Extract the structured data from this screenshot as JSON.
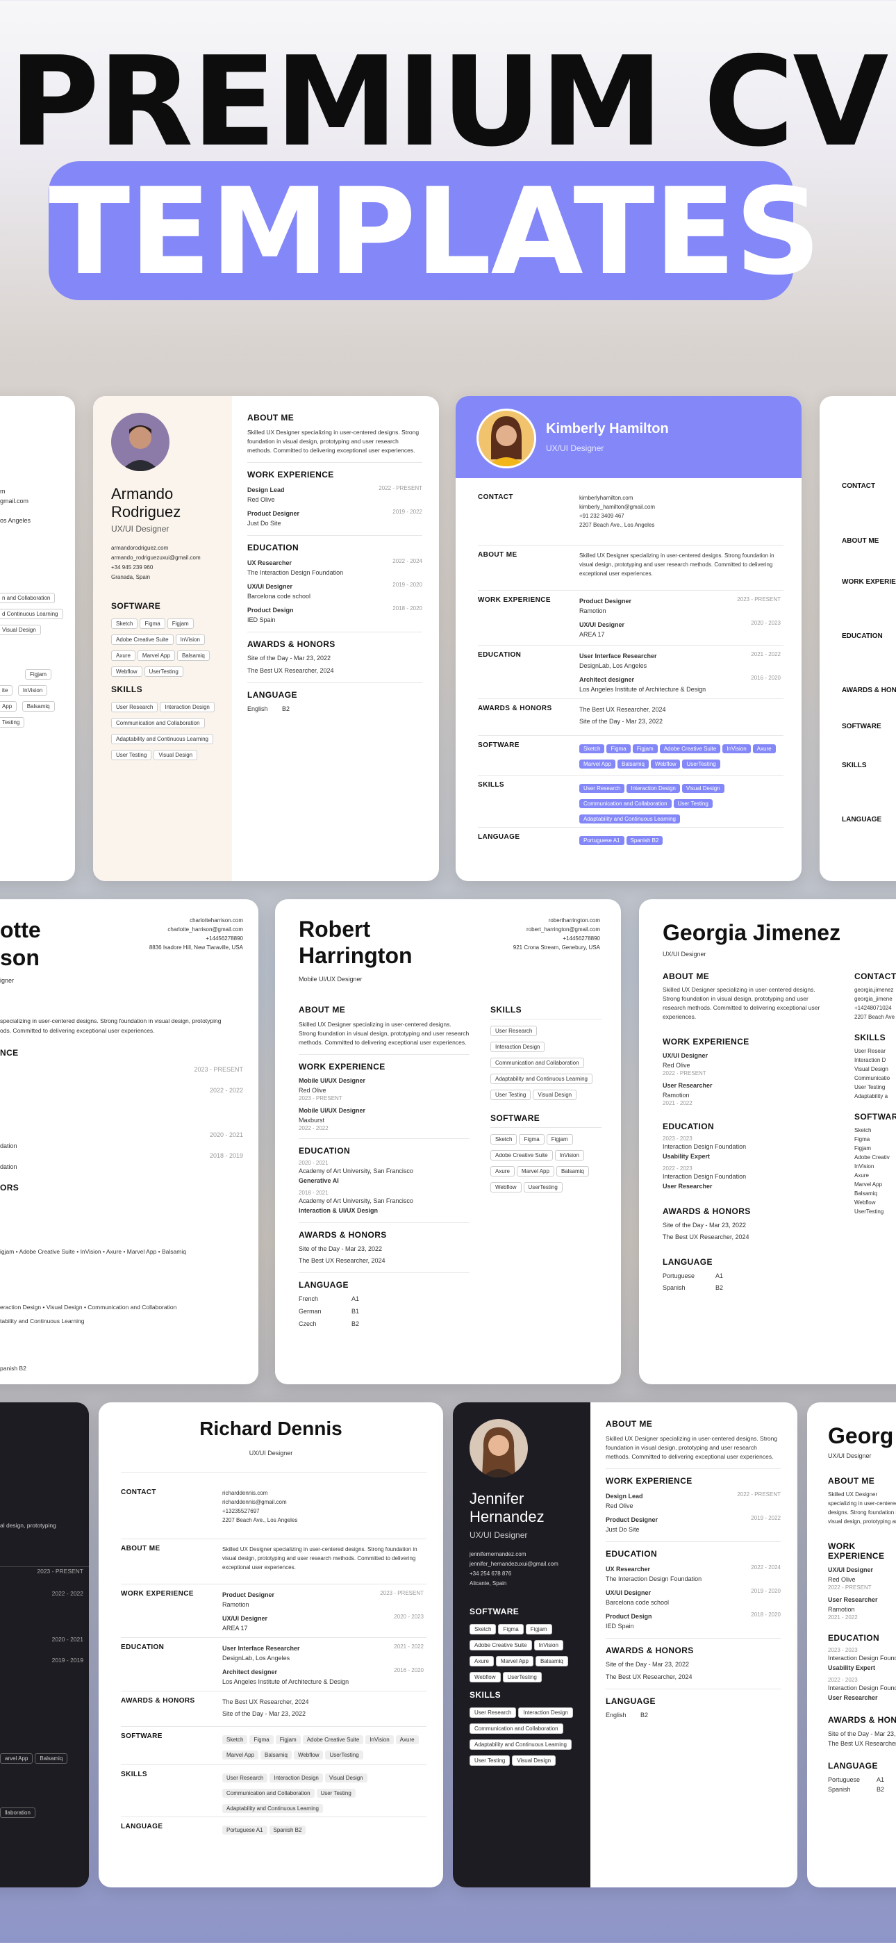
{
  "title_line1": "PREMIUM CV",
  "title_line2": "TEMPLATES",
  "about": "Skilled UX Designer specializing in user-centered designs. Strong foundation in visual design, prototyping and user research methods. Committed to delivering exceptional user experiences.",
  "armando": {
    "name": "Armando Rodriguez",
    "role": "UX/UI Designer",
    "contact": [
      "armandorodriguez.com",
      "armando_rodriguezuxui@gmail.com",
      "+34 945 239 960",
      "Granada, Spain"
    ],
    "software": [
      "Sketch",
      "Figma",
      "Figjam",
      "Adobe Creative Suite",
      "InVision",
      "Axure",
      "Marvel App",
      "Balsamiq",
      "Webflow",
      "UserTesting"
    ],
    "skills": [
      "User Research",
      "Interaction Design",
      "Communication and Collaboration",
      "Adaptability and Continuous Learning",
      "User Testing",
      "Visual Design"
    ],
    "jobs": [
      {
        "t": "Design Lead",
        "c": "Red Olive",
        "d": "2022 - PRESENT"
      },
      {
        "t": "Product Designer",
        "c": "Just Do Site",
        "d": "2019 - 2022"
      }
    ],
    "edu": [
      {
        "t": "UX Researcher",
        "c": "The Interaction Design Foundation",
        "d": "2022 - 2024"
      },
      {
        "t": "UX/UI Designer",
        "c": "Barcelona code school",
        "d": "2019 - 2020"
      },
      {
        "t": "Product Design",
        "c": "IED Spain",
        "d": "2018 - 2020"
      }
    ],
    "awards": [
      "Site of the Day - Mar 23, 2022",
      "The Best UX Researcher, 2024"
    ],
    "lang": "English",
    "lvl": "B2"
  },
  "kimberly": {
    "name": "Kimberly Hamilton",
    "role": "UX/UI Designer",
    "contact": [
      "kimberlyhamilton.com",
      "kimberly_hamilton@gmail.com",
      "+91 232 3409 467",
      "2207 Beach Ave., Los Angeles"
    ],
    "jobs": [
      {
        "t": "Product Designer",
        "c": "Ramotion",
        "d": "2023 - PRESENT"
      },
      {
        "t": "UX/UI Designer",
        "c": "AREA 17",
        "d": "2020 - 2023"
      }
    ],
    "edu": [
      {
        "t": "User Interface Researcher",
        "c": "DesignLab, Los Angeles",
        "d": "2021 - 2022"
      },
      {
        "t": "Architect designer",
        "c": "Los Angeles Institute of Architecture & Design",
        "d": "2016 - 2020"
      }
    ],
    "awards": [
      "The Best UX Researcher, 2024",
      "Site of the Day - Mar 23, 2022"
    ],
    "software": [
      "Sketch",
      "Figma",
      "Figjam",
      "Adobe Creative Suite",
      "InVision",
      "Axure",
      "Marvel App",
      "Balsamiq",
      "Webflow",
      "UserTesting"
    ],
    "skills": [
      "User Research",
      "Interaction Design",
      "Visual Design",
      "Communication and Collaboration",
      "User Testing",
      "Adaptability and Continuous Learning"
    ],
    "langs": [
      {
        "l": "Portuguese",
        "v": "A1"
      },
      {
        "l": "Spanish",
        "v": "B2"
      }
    ]
  },
  "labels": {
    "about": "ABOUT ME",
    "work": "WORK EXPERIENCE",
    "edu": "EDUCATION",
    "awards": "AWARDS & HONORS",
    "lang": "LANGUAGE",
    "software": "SOFTWARE",
    "skills": "SKILLS",
    "contact": "CONTACT"
  },
  "charlotte": {
    "name1": "otte",
    "name2": "son",
    "role": "igner",
    "contact": [
      "charlotteharrison.com",
      "charlotte_harrison@gmail.com",
      "+14456278890",
      "8836 Isadore Hill, New Tiaraville, USA"
    ],
    "about": "specializing in user-centered designs. Strong foundation in visual design, prototyping ods. Committed to delivering exceptional user experiences.",
    "d1": "2023 - PRESENT",
    "d2": "2022 - 2022",
    "d3": "2020 - 2021",
    "d4": "2018 - 2019",
    "sw": "igjam  •  Adobe Creative Suite  •  InVision  •  Axure  •  Marvel App  •  Balsamiq",
    "sk": "eraction Design  •  Visual Design  •  Communication and Collaboration",
    "sk2": "tability and Continuous Learning",
    "lang": "panish   B2",
    "w": "NCE",
    "o": "ORS",
    "n1": "dation",
    "n2": "dation"
  },
  "robert": {
    "name": "Robert Harrington",
    "role": "Mobile UI/UX Designer",
    "contact": [
      "robertharrington.com",
      "robert_harrington@gmail.com",
      "+14456278890",
      "921 Crona Stream, Genebury, USA"
    ],
    "jobs": [
      {
        "t": "Mobile UI/UX Designer",
        "c": "Red Olive",
        "d": "2023 - PRESENT"
      },
      {
        "t": "Mobile UI/UX Designer",
        "c": "Maxburst",
        "d": "2022 - 2022"
      }
    ],
    "edu": [
      {
        "d": "2020 - 2021",
        "c": "Academy of Art University, San Francisco",
        "t": "Generative AI"
      },
      {
        "d": "2018 - 2021",
        "c": "Academy of Art University, San Francisco",
        "t": "Interaction & UI/UX Design"
      }
    ],
    "langs": [
      {
        "l": "French",
        "v": "A1"
      },
      {
        "l": "German",
        "v": "B1"
      },
      {
        "l": "Czech",
        "v": "B2"
      }
    ],
    "skills": [
      "User Research",
      "Interaction Design",
      "Communication and Collaboration",
      "Adaptability and Continuous Learning",
      "User Testing",
      "Visual Design"
    ],
    "software": [
      "Sketch",
      "Figma",
      "Figjam",
      "Adobe Creative Suite",
      "InVision",
      "Axure",
      "Marvel App",
      "Balsamiq",
      "Webflow",
      "UserTesting"
    ]
  },
  "georgia": {
    "name": "Georgia Jimenez",
    "role": "UX/UI Designer",
    "jobs": [
      {
        "t": "UX/UI Designer",
        "c": "Red Olive",
        "d": "2022 - PRESENT"
      },
      {
        "t": "User Researcher",
        "c": "Ramotion",
        "d": "2021 - 2022"
      }
    ],
    "edu": [
      {
        "d": "2023 - 2023",
        "c": "Interaction Design Foundation",
        "t": "Usability Expert"
      },
      {
        "d": "2022 - 2023",
        "c": "Interaction Design Foundation",
        "t": "User Researcher"
      }
    ],
    "langs": [
      {
        "l": "Portuguese",
        "v": "A1"
      },
      {
        "l": "Spanish",
        "v": "B2"
      }
    ],
    "contact": [
      "georgia.jimenez",
      "georgia_jimene",
      "+14248071024",
      "2207 Beach Ave"
    ],
    "skills": [
      "User Resear",
      "Interaction D",
      "Visual Design",
      "Communicatio",
      "User Testing",
      "Adaptability a"
    ],
    "software": [
      "Sketch",
      "Figma",
      "Figjam",
      "Adobe Creativ",
      "InVision",
      "Axure",
      "Marvel App",
      "Balsamiq",
      "Webflow",
      "UserTesting"
    ],
    "name_cut": "Georg"
  },
  "richard": {
    "name": "Richard Dennis",
    "role": "UX/UI Designer",
    "contact": [
      "richarddennis.com",
      "richarddennis@gmail.com",
      "+13235527697",
      "2207 Beach Ave., Los Angeles"
    ],
    "jobs": [
      {
        "t": "Product Designer",
        "c": "Ramotion",
        "d": "2023 - PRESENT"
      },
      {
        "t": "UX/UI Designer",
        "c": "AREA 17",
        "d": "2020 - 2023"
      }
    ],
    "edu": [
      {
        "t": "User Interface Researcher",
        "c": "DesignLab, Los Angeles",
        "d": "2021 - 2022"
      },
      {
        "t": "Architect designer",
        "c": "Los Angeles Institute of Architecture & Design",
        "d": "2016 - 2020"
      }
    ],
    "awards": [
      "The Best UX Researcher, 2024",
      "Site of the Day - Mar 23, 2022"
    ],
    "software": [
      "Sketch",
      "Figma",
      "Figjam",
      "Adobe Creative Suite",
      "InVision",
      "Axure",
      "Marvel App",
      "Balsamiq",
      "Webflow",
      "UserTesting"
    ],
    "skills": [
      "User Research",
      "Interaction Design",
      "Visual Design",
      "Communication and Collaboration",
      "User Testing",
      "Adaptability and Continuous Learning"
    ],
    "langs": [
      {
        "l": "Portuguese",
        "v": "A1"
      },
      {
        "l": "Spanish",
        "v": "B2"
      }
    ]
  },
  "jennifer": {
    "name": "Jennifer Hernandez",
    "role": "UX/UI Designer",
    "contact": [
      "jennifernernandez.com",
      "jennifer_hernandezuxui@gmail.com",
      "+34 254 678 876",
      "Alicante, Spain"
    ],
    "software": [
      "Sketch",
      "Figma",
      "Figjam",
      "Adobe Creative Suite",
      "InVision",
      "Axure",
      "Marvel App",
      "Balsamiq",
      "Webflow",
      "UserTesting"
    ],
    "skills": [
      "User Research",
      "Interaction Design",
      "Communication and Collaboration",
      "Adaptability and Continuous Learning",
      "User Testing",
      "Visual Design"
    ],
    "jobs": [
      {
        "t": "Design Lead",
        "c": "Red Olive",
        "d": "2022 - PRESENT"
      },
      {
        "t": "Product Designer",
        "c": "Just Do Site",
        "d": "2019 - 2022"
      }
    ],
    "edu": [
      {
        "t": "UX Researcher",
        "c": "The Interaction Design Foundation",
        "d": "2022 - 2024"
      },
      {
        "t": "UX/UI Designer",
        "c": "Barcelona code school",
        "d": "2019 - 2020"
      },
      {
        "t": "Product Design",
        "c": "IED Spain",
        "d": "2018 - 2020"
      }
    ],
    "awards": [
      "Site of the Day - Mar 23, 2022",
      "The Best UX Researcher, 2024"
    ],
    "lang": "English",
    "lvl": "B2"
  },
  "left1": {
    "contact": [
      "m",
      "gmail.com",
      "",
      "os Angeles"
    ],
    "skills": [
      "n and Collaboration",
      "d Continuous Learning",
      "Visual Design"
    ],
    "sw": [
      "Figjam",
      "ite",
      "InVision",
      "App",
      "Balsamiq",
      "Testing"
    ]
  },
  "left3": {
    "about": "al design, prototyping",
    "d1": "2023 - PRESENT",
    "d2": "2022 - 2022",
    "d3": "2020 - 2021",
    "d4": "2019 - 2019",
    "sw": [
      "arvel App",
      "Balsamiq"
    ],
    "sk": "llaboration"
  },
  "colors": {
    "accent": "#8387f7",
    "dark": "#1c1c22",
    "cream": "#faf4ec"
  }
}
